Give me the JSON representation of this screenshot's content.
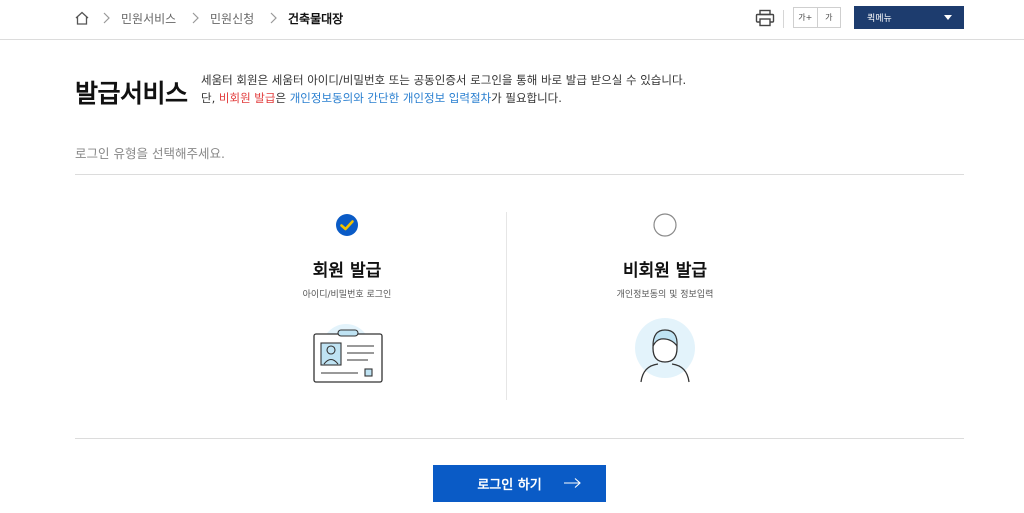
{
  "breadcrumb": {
    "items": [
      "민원서비스",
      "민원신청",
      "건축물대장"
    ]
  },
  "toolbar": {
    "font_larger": "가+",
    "font_normal": "가",
    "quick_menu": "퀵메뉴"
  },
  "page": {
    "title": "발급서비스",
    "desc_line1_strong": "세움터 회원",
    "desc_line1_rest": "은 세움터 아이디/비밀번호 또는 공동인증서 로그인을 통해 바로 발급 받으실 수 있습니다.",
    "desc_line2_prefix": "단, ",
    "desc_line2_red": "비회원 발급",
    "desc_line2_mid": "은 ",
    "desc_line2_blue": "개인정보동의와 간단한 개인정보 입력절차",
    "desc_line2_suffix": "가 필요합니다.",
    "guide": "로그인 유형을 선택해주세요."
  },
  "options": [
    {
      "title": "회원 발급",
      "subtitle": "아이디/비밀번호 로그인",
      "selected": true
    },
    {
      "title": "비회원 발급",
      "subtitle": "개인정보동의 및 정보입력",
      "selected": false
    }
  ],
  "actions": {
    "login": "로그인 하기"
  },
  "colors": {
    "primary": "#0a5bc6",
    "navy": "#1d3c6e",
    "check": "#f2c200",
    "red_text": "#e23c3c",
    "blue_text": "#2a7fd0"
  },
  "icons": [
    "home-icon",
    "chevron-right-icon",
    "print-icon",
    "caret-down-icon",
    "check-circle-icon",
    "radio-empty-icon",
    "id-card-icon",
    "person-icon",
    "arrow-right-icon"
  ]
}
